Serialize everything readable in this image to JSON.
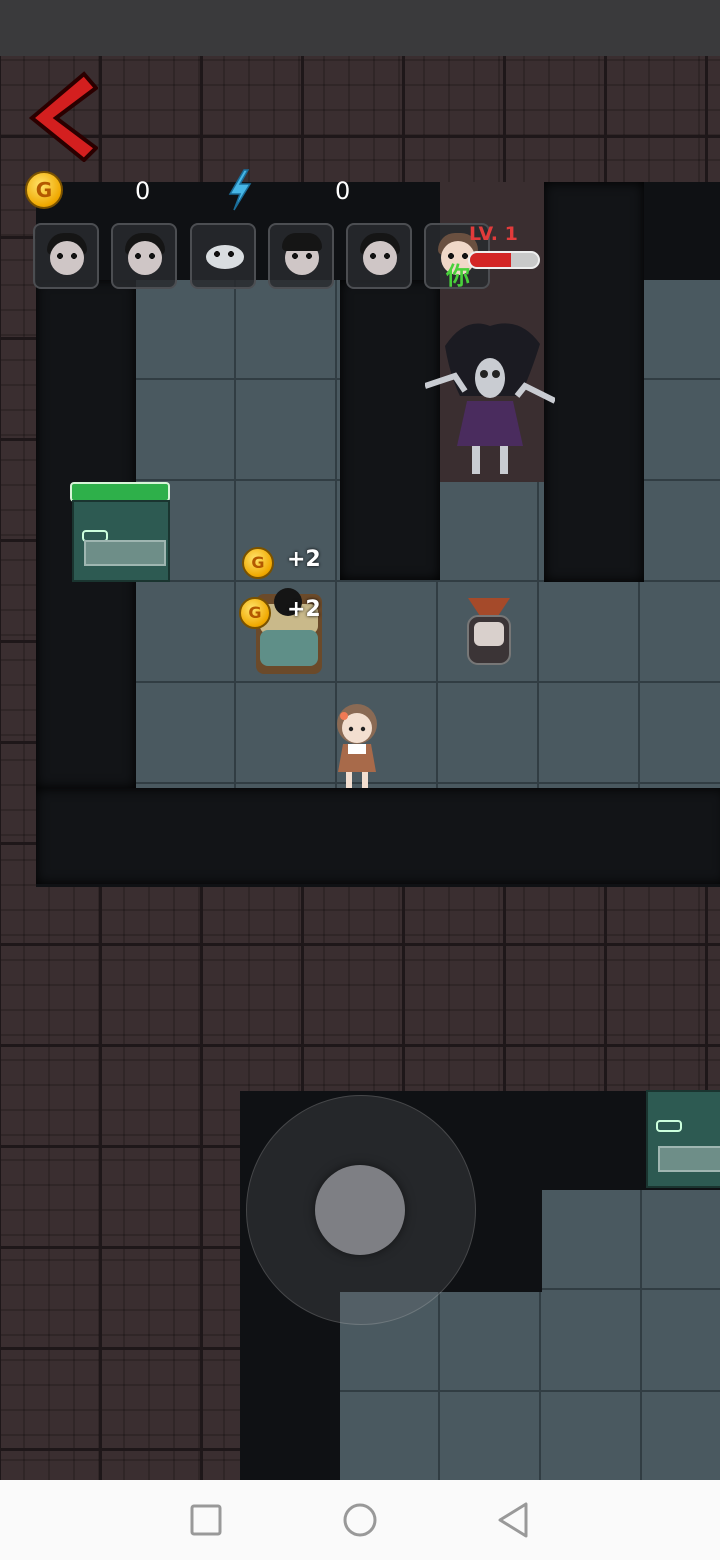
{
  "hud": {
    "coin_icon": "gold-coin-icon",
    "coin_letter": "G",
    "coin_count": "0",
    "energy_icon": "lightning-icon",
    "energy_count": "0"
  },
  "portraits": [
    {
      "name": "portrait-girl-bow-1"
    },
    {
      "name": "portrait-girl-bow-2"
    },
    {
      "name": "portrait-ghost-blob"
    },
    {
      "name": "portrait-boy-dark-hair"
    },
    {
      "name": "portrait-girl-bow-3"
    },
    {
      "name": "portrait-player"
    }
  ],
  "player_tag": {
    "level": "LV. 1",
    "you_label": "你",
    "health_fraction": 0.6
  },
  "pickups": [
    {
      "coin_letter": "G",
      "amount": "+2"
    },
    {
      "coin_letter": "G",
      "amount": "+2"
    }
  ],
  "door_health_fraction": 1.0,
  "colors": {
    "hp": "#d32525",
    "you": "#49d13b",
    "door_hp": "#2eb04a",
    "back_arrow": "#d41f1f"
  },
  "nav": {
    "square": "recent-apps-icon",
    "circle": "home-icon",
    "triangle": "back-icon"
  }
}
